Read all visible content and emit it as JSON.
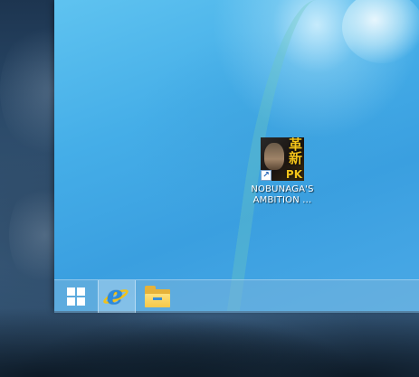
{
  "desktop": {
    "shortcut": {
      "label_line1": "NOBUNAGA'S",
      "label_line2": "AMBITION ...",
      "icon_kanji_1": "革",
      "icon_kanji_2": "新",
      "icon_badge": "PK",
      "icon": "game-shortcut-icon",
      "overlay_icon": "shortcut-arrow-icon",
      "overlay_glyph": "↗"
    }
  },
  "taskbar": {
    "buttons": [
      {
        "icon": "windows-start-icon"
      },
      {
        "icon": "internet-explorer-icon",
        "glyph": "e"
      },
      {
        "icon": "file-explorer-icon"
      }
    ]
  },
  "colors": {
    "desktop_accent": "#45aee8",
    "taskbar": "#78b4dc",
    "kanji": "#f2c21a",
    "ie_blue": "#2a8be0",
    "ie_ring": "#f2c21a",
    "folder": "#f5c84a"
  }
}
